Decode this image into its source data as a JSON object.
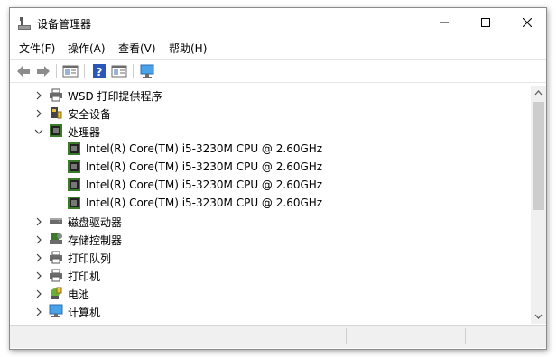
{
  "window": {
    "title": "设备管理器",
    "title_icon": "device-manager-icon"
  },
  "menu": [
    {
      "label": "文件(F)"
    },
    {
      "label": "操作(A)"
    },
    {
      "label": "查看(V)"
    },
    {
      "label": "帮助(H)"
    }
  ],
  "toolbar": {
    "buttons": [
      "back-icon",
      "forward-icon",
      "properties-icon",
      "help-icon",
      "view-icon",
      "monitor-scan-icon"
    ]
  },
  "tree": {
    "items": [
      {
        "label": "WSD 打印提供程序",
        "expanded": false,
        "icon": "printer-icon",
        "level": 0
      },
      {
        "label": "安全设备",
        "expanded": false,
        "icon": "security-device-icon",
        "level": 0
      },
      {
        "label": "处理器",
        "expanded": true,
        "icon": "processor-icon",
        "level": 0
      },
      {
        "label": "Intel(R) Core(TM) i5-3230M CPU @ 2.60GHz",
        "icon": "processor-icon",
        "level": 1
      },
      {
        "label": "Intel(R) Core(TM) i5-3230M CPU @ 2.60GHz",
        "icon": "processor-icon",
        "level": 1
      },
      {
        "label": "Intel(R) Core(TM) i5-3230M CPU @ 2.60GHz",
        "icon": "processor-icon",
        "level": 1
      },
      {
        "label": "Intel(R) Core(TM) i5-3230M CPU @ 2.60GHz",
        "icon": "processor-icon",
        "level": 1
      },
      {
        "label": "磁盘驱动器",
        "expanded": false,
        "icon": "disk-drive-icon",
        "level": 0
      },
      {
        "label": "存储控制器",
        "expanded": false,
        "icon": "storage-controller-icon",
        "level": 0
      },
      {
        "label": "打印队列",
        "expanded": false,
        "icon": "printer-icon",
        "level": 0
      },
      {
        "label": "打印机",
        "expanded": false,
        "icon": "printer-icon",
        "level": 0
      },
      {
        "label": "电池",
        "expanded": false,
        "icon": "battery-icon",
        "level": 0
      },
      {
        "label": "计算机",
        "expanded": false,
        "icon": "computer-icon",
        "level": 0
      }
    ]
  },
  "colors": {
    "accent": "#0078d7",
    "chip_green": "#3a7a2a"
  }
}
